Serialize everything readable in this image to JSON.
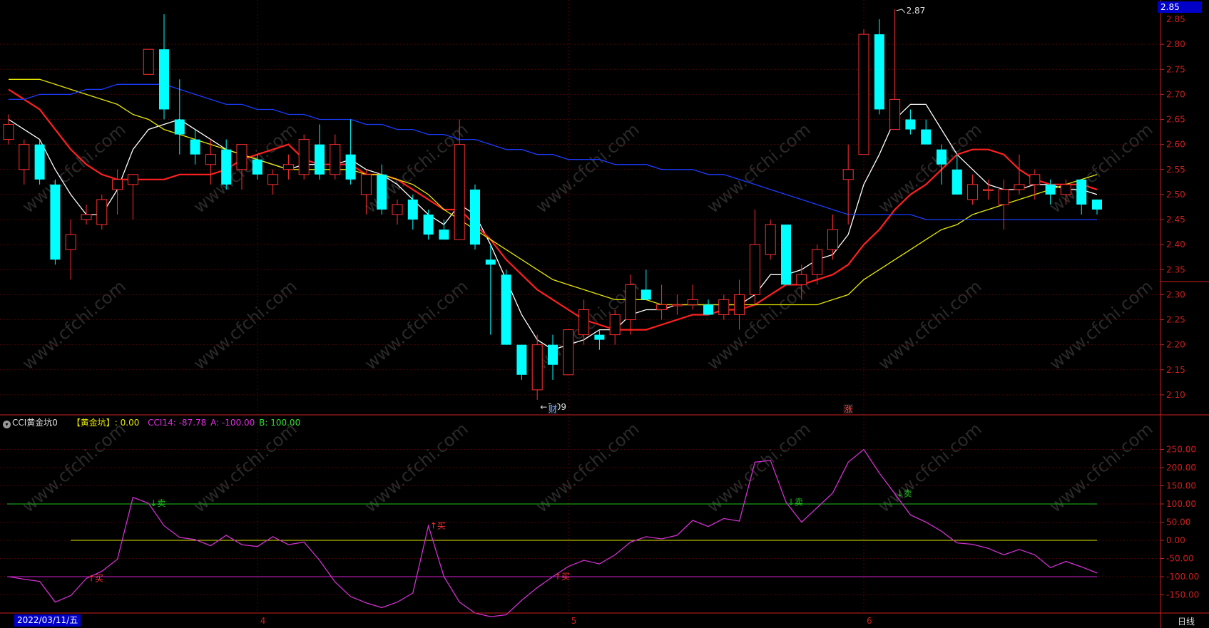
{
  "chart_data": [
    {
      "type": "candlestick",
      "ylim": [
        2.06,
        2.86
      ],
      "yticks": [
        "2.80",
        "2.75",
        "2.70",
        "2.65",
        "2.60",
        "2.55",
        "2.50",
        "2.45",
        "2.40",
        "2.35",
        "2.30",
        "2.25",
        "2.20",
        "2.15",
        "2.10"
      ],
      "top_tick_partial": "2.85",
      "last_price": "2.85",
      "high_label": "2.87",
      "low_label": "2.09",
      "candles": [
        {
          "o": 2.61,
          "h": 2.66,
          "l": 2.6,
          "c": 2.64
        },
        {
          "o": 2.55,
          "h": 2.61,
          "l": 2.52,
          "c": 2.6
        },
        {
          "o": 2.6,
          "h": 2.61,
          "l": 2.52,
          "c": 2.53
        },
        {
          "o": 2.52,
          "h": 2.53,
          "l": 2.36,
          "c": 2.37
        },
        {
          "o": 2.39,
          "h": 2.45,
          "l": 2.33,
          "c": 2.42
        },
        {
          "o": 2.45,
          "h": 2.48,
          "l": 2.44,
          "c": 2.46
        },
        {
          "o": 2.44,
          "h": 2.5,
          "l": 2.43,
          "c": 2.49
        },
        {
          "o": 2.51,
          "h": 2.55,
          "l": 2.46,
          "c": 2.53
        },
        {
          "o": 2.52,
          "h": 2.54,
          "l": 2.45,
          "c": 2.54
        },
        {
          "o": 2.74,
          "h": 2.79,
          "l": 2.74,
          "c": 2.79
        },
        {
          "o": 2.79,
          "h": 2.86,
          "l": 2.65,
          "c": 2.67
        },
        {
          "o": 2.65,
          "h": 2.73,
          "l": 2.58,
          "c": 2.62
        },
        {
          "o": 2.61,
          "h": 2.63,
          "l": 2.56,
          "c": 2.58
        },
        {
          "o": 2.56,
          "h": 2.61,
          "l": 2.52,
          "c": 2.58
        },
        {
          "o": 2.59,
          "h": 2.61,
          "l": 2.51,
          "c": 2.52
        },
        {
          "o": 2.55,
          "h": 2.6,
          "l": 2.51,
          "c": 2.6
        },
        {
          "o": 2.57,
          "h": 2.58,
          "l": 2.53,
          "c": 2.54
        },
        {
          "o": 2.52,
          "h": 2.55,
          "l": 2.5,
          "c": 2.54
        },
        {
          "o": 2.55,
          "h": 2.58,
          "l": 2.53,
          "c": 2.56
        },
        {
          "o": 2.54,
          "h": 2.62,
          "l": 2.53,
          "c": 2.61
        },
        {
          "o": 2.6,
          "h": 2.64,
          "l": 2.53,
          "c": 2.54
        },
        {
          "o": 2.54,
          "h": 2.62,
          "l": 2.53,
          "c": 2.6
        },
        {
          "o": 2.58,
          "h": 2.65,
          "l": 2.52,
          "c": 2.53
        },
        {
          "o": 2.5,
          "h": 2.55,
          "l": 2.46,
          "c": 2.54
        },
        {
          "o": 2.54,
          "h": 2.56,
          "l": 2.46,
          "c": 2.47
        },
        {
          "o": 2.46,
          "h": 2.49,
          "l": 2.44,
          "c": 2.48
        },
        {
          "o": 2.49,
          "h": 2.5,
          "l": 2.43,
          "c": 2.45
        },
        {
          "o": 2.46,
          "h": 2.47,
          "l": 2.41,
          "c": 2.42
        },
        {
          "o": 2.43,
          "h": 2.45,
          "l": 2.41,
          "c": 2.41
        },
        {
          "o": 2.41,
          "h": 2.65,
          "l": 2.41,
          "c": 2.6
        },
        {
          "o": 2.51,
          "h": 2.52,
          "l": 2.39,
          "c": 2.4
        },
        {
          "o": 2.37,
          "h": 2.4,
          "l": 2.22,
          "c": 2.36
        },
        {
          "o": 2.34,
          "h": 2.35,
          "l": 2.2,
          "c": 2.2
        },
        {
          "o": 2.2,
          "h": 2.2,
          "l": 2.13,
          "c": 2.14
        },
        {
          "o": 2.11,
          "h": 2.22,
          "l": 2.09,
          "c": 2.2
        },
        {
          "o": 2.2,
          "h": 2.22,
          "l": 2.13,
          "c": 2.16
        },
        {
          "o": 2.14,
          "h": 2.23,
          "l": 2.14,
          "c": 2.23
        },
        {
          "o": 2.22,
          "h": 2.29,
          "l": 2.2,
          "c": 2.27
        },
        {
          "o": 2.22,
          "h": 2.23,
          "l": 2.19,
          "c": 2.21
        },
        {
          "o": 2.22,
          "h": 2.27,
          "l": 2.2,
          "c": 2.26
        },
        {
          "o": 2.25,
          "h": 2.34,
          "l": 2.22,
          "c": 2.32
        },
        {
          "o": 2.31,
          "h": 2.35,
          "l": 2.29,
          "c": 2.29
        },
        {
          "o": 2.27,
          "h": 2.32,
          "l": 2.25,
          "c": 2.28
        },
        {
          "o": 2.28,
          "h": 2.3,
          "l": 2.26,
          "c": 2.28
        },
        {
          "o": 2.28,
          "h": 2.32,
          "l": 2.27,
          "c": 2.29
        },
        {
          "o": 2.28,
          "h": 2.29,
          "l": 2.26,
          "c": 2.26
        },
        {
          "o": 2.26,
          "h": 2.3,
          "l": 2.25,
          "c": 2.29
        },
        {
          "o": 2.26,
          "h": 2.33,
          "l": 2.23,
          "c": 2.3
        },
        {
          "o": 2.3,
          "h": 2.47,
          "l": 2.28,
          "c": 2.4
        },
        {
          "o": 2.38,
          "h": 2.45,
          "l": 2.37,
          "c": 2.44
        },
        {
          "o": 2.44,
          "h": 2.44,
          "l": 2.32,
          "c": 2.32
        },
        {
          "o": 2.32,
          "h": 2.36,
          "l": 2.29,
          "c": 2.34
        },
        {
          "o": 2.34,
          "h": 2.4,
          "l": 2.32,
          "c": 2.39
        },
        {
          "o": 2.39,
          "h": 2.46,
          "l": 2.37,
          "c": 2.43
        },
        {
          "o": 2.53,
          "h": 2.6,
          "l": 2.44,
          "c": 2.55
        },
        {
          "o": 2.58,
          "h": 2.83,
          "l": 2.58,
          "c": 2.82
        },
        {
          "o": 2.82,
          "h": 2.85,
          "l": 2.66,
          "c": 2.67
        },
        {
          "o": 2.63,
          "h": 2.87,
          "l": 2.63,
          "c": 2.69
        },
        {
          "o": 2.65,
          "h": 2.67,
          "l": 2.62,
          "c": 2.63
        },
        {
          "o": 2.63,
          "h": 2.65,
          "l": 2.6,
          "c": 2.6
        },
        {
          "o": 2.59,
          "h": 2.6,
          "l": 2.52,
          "c": 2.56
        },
        {
          "o": 2.55,
          "h": 2.58,
          "l": 2.5,
          "c": 2.5
        },
        {
          "o": 2.49,
          "h": 2.54,
          "l": 2.48,
          "c": 2.52
        },
        {
          "o": 2.51,
          "h": 2.53,
          "l": 2.49,
          "c": 2.51
        },
        {
          "o": 2.48,
          "h": 2.53,
          "l": 2.43,
          "c": 2.51
        },
        {
          "o": 2.51,
          "h": 2.58,
          "l": 2.5,
          "c": 2.52
        },
        {
          "o": 2.52,
          "h": 2.55,
          "l": 2.49,
          "c": 2.54
        },
        {
          "o": 2.52,
          "h": 2.53,
          "l": 2.48,
          "c": 2.5
        },
        {
          "o": 2.5,
          "h": 2.53,
          "l": 2.48,
          "c": 2.52
        },
        {
          "o": 2.53,
          "h": 2.53,
          "l": 2.46,
          "c": 2.48
        },
        {
          "o": 2.49,
          "h": 2.49,
          "l": 2.46,
          "c": 2.47
        }
      ],
      "moving_averages": [
        {
          "color": "#ffffff",
          "values": [
            2.65,
            2.63,
            2.61,
            2.55,
            2.5,
            2.46,
            2.46,
            2.51,
            2.59,
            2.63,
            2.64,
            2.65,
            2.63,
            2.61,
            2.59,
            2.58,
            2.57,
            2.56,
            2.55,
            2.56,
            2.56,
            2.56,
            2.57,
            2.55,
            2.54,
            2.52,
            2.49,
            2.46,
            2.44,
            2.48,
            2.46,
            2.4,
            2.33,
            2.26,
            2.21,
            2.19,
            2.2,
            2.21,
            2.23,
            2.23,
            2.26,
            2.27,
            2.27,
            2.28,
            2.28,
            2.28,
            2.28,
            2.28,
            2.3,
            2.34,
            2.34,
            2.35,
            2.37,
            2.38,
            2.42,
            2.52,
            2.58,
            2.65,
            2.68,
            2.68,
            2.63,
            2.58,
            2.55,
            2.52,
            2.51,
            2.51,
            2.52,
            2.52,
            2.51,
            2.51,
            2.5
          ]
        },
        {
          "color": "#ff2020",
          "values": [
            2.71,
            2.69,
            2.67,
            2.63,
            2.59,
            2.56,
            2.54,
            2.53,
            2.53,
            2.53,
            2.53,
            2.54,
            2.54,
            2.54,
            2.55,
            2.57,
            2.58,
            2.59,
            2.6,
            2.57,
            2.56,
            2.56,
            2.56,
            2.54,
            2.54,
            2.53,
            2.51,
            2.49,
            2.47,
            2.47,
            2.44,
            2.41,
            2.37,
            2.34,
            2.31,
            2.29,
            2.27,
            2.25,
            2.24,
            2.23,
            2.23,
            2.23,
            2.24,
            2.25,
            2.26,
            2.26,
            2.27,
            2.27,
            2.28,
            2.3,
            2.32,
            2.32,
            2.33,
            2.34,
            2.36,
            2.4,
            2.43,
            2.47,
            2.5,
            2.52,
            2.55,
            2.58,
            2.59,
            2.59,
            2.58,
            2.55,
            2.53,
            2.52,
            2.52,
            2.52,
            2.51
          ]
        },
        {
          "color": "#e6e600",
          "values": [
            2.73,
            2.73,
            2.73,
            2.72,
            2.71,
            2.7,
            2.69,
            2.68,
            2.66,
            2.65,
            2.63,
            2.62,
            2.61,
            2.6,
            2.59,
            2.58,
            2.57,
            2.56,
            2.55,
            2.55,
            2.55,
            2.55,
            2.55,
            2.54,
            2.54,
            2.53,
            2.52,
            2.5,
            2.47,
            2.45,
            2.43,
            2.41,
            2.39,
            2.37,
            2.35,
            2.33,
            2.32,
            2.31,
            2.3,
            2.29,
            2.29,
            2.29,
            2.28,
            2.28,
            2.28,
            2.28,
            2.28,
            2.28,
            2.28,
            2.28,
            2.28,
            2.28,
            2.28,
            2.29,
            2.3,
            2.33,
            2.35,
            2.37,
            2.39,
            2.41,
            2.43,
            2.44,
            2.46,
            2.47,
            2.48,
            2.49,
            2.5,
            2.51,
            2.52,
            2.53,
            2.54
          ]
        },
        {
          "color": "#1a3cff",
          "values": [
            2.69,
            2.69,
            2.7,
            2.7,
            2.7,
            2.71,
            2.71,
            2.72,
            2.72,
            2.72,
            2.72,
            2.71,
            2.7,
            2.69,
            2.68,
            2.68,
            2.67,
            2.67,
            2.66,
            2.66,
            2.65,
            2.65,
            2.65,
            2.64,
            2.64,
            2.63,
            2.63,
            2.62,
            2.62,
            2.61,
            2.61,
            2.6,
            2.59,
            2.59,
            2.58,
            2.58,
            2.57,
            2.57,
            2.57,
            2.56,
            2.56,
            2.56,
            2.55,
            2.55,
            2.55,
            2.54,
            2.54,
            2.53,
            2.52,
            2.51,
            2.5,
            2.49,
            2.48,
            2.47,
            2.46,
            2.46,
            2.46,
            2.46,
            2.46,
            2.45,
            2.45,
            2.45,
            2.45,
            2.45,
            2.45,
            2.45,
            2.45,
            2.45,
            2.45,
            2.45,
            2.45
          ]
        }
      ],
      "event_markers": [
        {
          "index": 35,
          "label": "财",
          "color": "#6fa8ff"
        },
        {
          "index": 54,
          "label": "涨",
          "color": "#ff4040"
        }
      ]
    },
    {
      "type": "line",
      "ylim": [
        -200,
        300
      ],
      "yticks": [
        "250.00",
        "200.00",
        "150.00",
        "100.00",
        "50.00",
        "0.00",
        "-50.00",
        "-100.00",
        "-150.00"
      ],
      "reference_lines": [
        {
          "value": 100,
          "color": "#1fbf1f"
        },
        {
          "value": 0,
          "color": "#e6e600",
          "start_index": 4
        },
        {
          "value": -100,
          "color": "#d020d0"
        }
      ],
      "series": [
        {
          "name": "CCI14",
          "color": "#d030d0",
          "values": [
            -100,
            -107,
            -113,
            -170,
            -152,
            -105,
            -85,
            -52,
            118,
            102,
            40,
            8,
            2,
            -15,
            14,
            -12,
            -17,
            10,
            -12,
            -5,
            -55,
            -115,
            -155,
            -172,
            -185,
            -170,
            -145,
            40,
            -100,
            -170,
            -200,
            -210,
            -205,
            -165,
            -130,
            -100,
            -72,
            -55,
            -65,
            -40,
            -5,
            10,
            4,
            14,
            55,
            38,
            60,
            53,
            215,
            220,
            105,
            50,
            90,
            130,
            215,
            250,
            185,
            128,
            70,
            50,
            25,
            -7,
            -11,
            -22,
            -40,
            -25,
            -40,
            -75,
            -58,
            -73,
            -90
          ]
        }
      ],
      "signals": [
        {
          "index": 5,
          "label": "↑买",
          "color": "#ff3030"
        },
        {
          "index": 9,
          "label": "↓卖",
          "color": "#1fbf1f"
        },
        {
          "index": 27,
          "label": "↑买",
          "color": "#ff3030"
        },
        {
          "index": 35,
          "label": "↑买",
          "color": "#ff3030"
        },
        {
          "index": 50,
          "label": "↓卖",
          "color": "#1fbf1f"
        },
        {
          "index": 57,
          "label": "↓卖",
          "color": "#1fbf1f"
        }
      ]
    }
  ],
  "cci_header": {
    "toggle_icon": "chevron-down-icon",
    "name": "CCI黄金坑0",
    "pit_label": "【黄金坑】: 0.00",
    "cci14": "CCI14: -87.78",
    "a": "A: -100.00",
    "b": "B: 100.00"
  },
  "xaxis": {
    "date_box": "2022/03/11/五",
    "month_labels": [
      {
        "index": 16,
        "label": "4"
      },
      {
        "index": 36,
        "label": "5"
      },
      {
        "index": 55,
        "label": "6"
      }
    ]
  },
  "period_label": "日线",
  "watermark": "www.cfchi.com",
  "colors": {
    "up": "#ff3030",
    "down": "#00ffff",
    "grid": "#550000",
    "axis": "#cc2020"
  }
}
